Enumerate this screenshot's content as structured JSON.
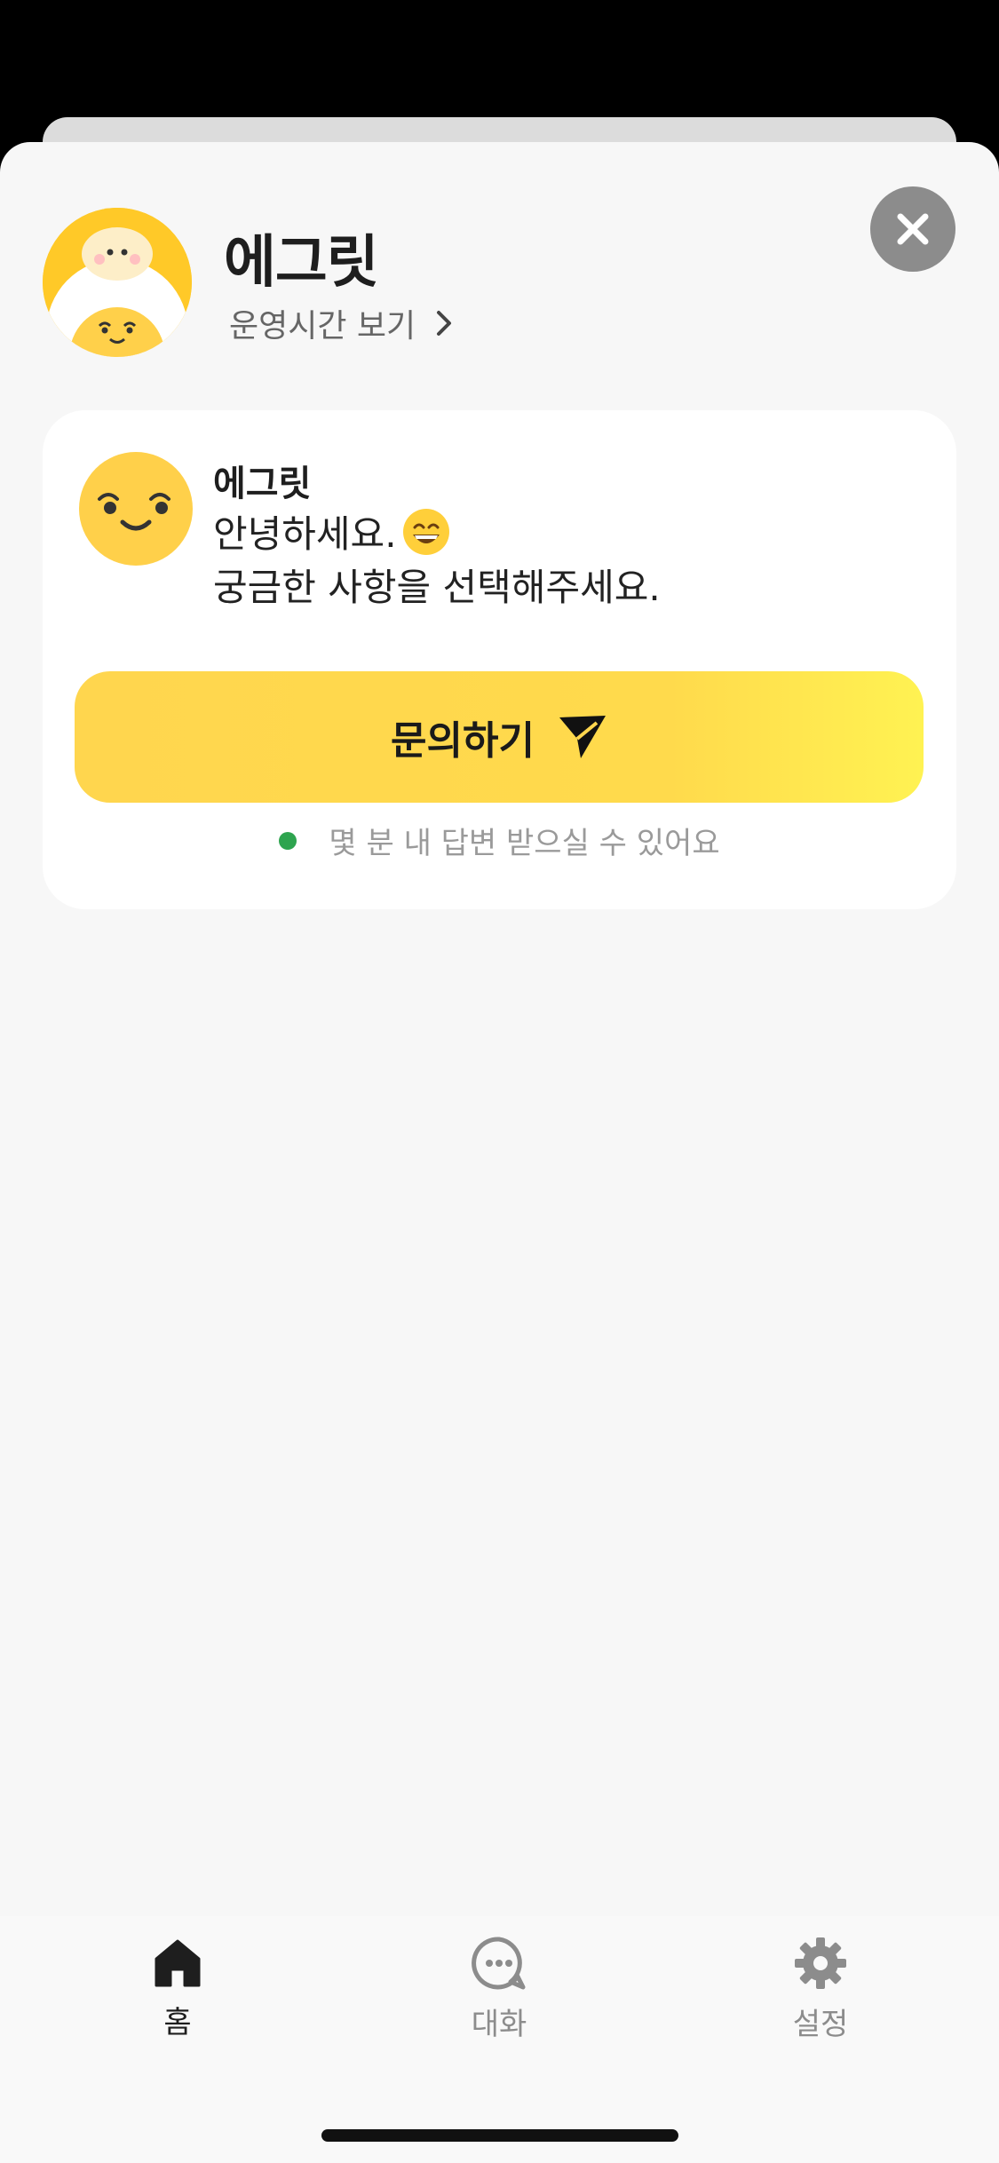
{
  "header": {
    "bot_name": "에그릿",
    "hours_link": "운영시간 보기"
  },
  "message": {
    "sender": "에그릿",
    "line1": "안녕하세요.",
    "line2": "궁금한 사항을 선택해주세요."
  },
  "inquiry_button": {
    "label": "문의하기"
  },
  "status": {
    "text": "몇 분 내 답변 받으실 수 있어요",
    "color": "#2ea44f"
  },
  "tabs": [
    {
      "label": "홈",
      "icon": "home-icon",
      "active": true
    },
    {
      "label": "대화",
      "icon": "chat-icon",
      "active": false
    },
    {
      "label": "설정",
      "icon": "gear-icon",
      "active": false
    }
  ],
  "colors": {
    "accent": "#ffd64e",
    "avatar": "#ffc928"
  }
}
